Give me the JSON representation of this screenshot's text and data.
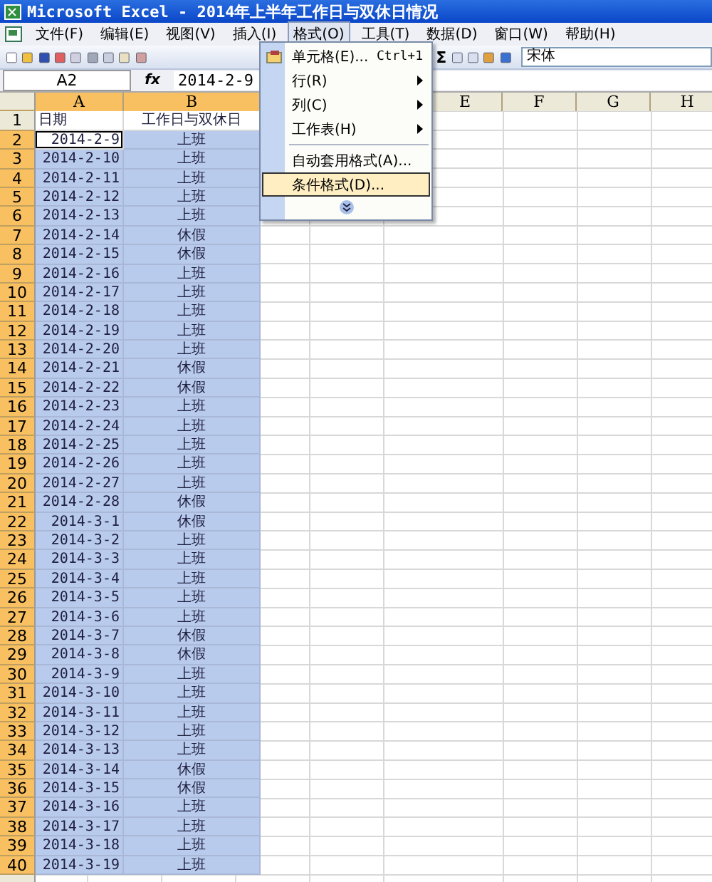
{
  "window": {
    "title": "Microsoft Excel - 2014年上半年工作日与双休日情况"
  },
  "menubar": [
    {
      "label": "文件(F)",
      "selected": false
    },
    {
      "label": "编辑(E)",
      "selected": false
    },
    {
      "label": "视图(V)",
      "selected": false
    },
    {
      "label": "插入(I)",
      "selected": false
    },
    {
      "label": "格式(O)",
      "selected": true
    },
    {
      "label": "工具(T)",
      "selected": false
    },
    {
      "label": "数据(D)",
      "selected": false
    },
    {
      "label": "窗口(W)",
      "selected": false
    },
    {
      "label": "帮助(H)",
      "selected": false
    }
  ],
  "toolbar": {
    "sum": "Σ",
    "font": "宋体"
  },
  "formula_bar": {
    "name_box": "A2",
    "fx": "fx",
    "value": "2014-2-9"
  },
  "format_menu": [
    {
      "kind": "item",
      "label": "单元格(E)...",
      "shortcut": "Ctrl+1",
      "submenu": false,
      "selected": false
    },
    {
      "kind": "item",
      "label": "行(R)",
      "submenu": true,
      "selected": false
    },
    {
      "kind": "item",
      "label": "列(C)",
      "submenu": true,
      "selected": false
    },
    {
      "kind": "item",
      "label": "工作表(H)",
      "submenu": true,
      "selected": false
    },
    {
      "kind": "separator"
    },
    {
      "kind": "item",
      "label": "自动套用格式(A)...",
      "submenu": false,
      "selected": false
    },
    {
      "kind": "item",
      "label": "条件格式(D)...",
      "submenu": false,
      "selected": true
    },
    {
      "kind": "expand"
    }
  ],
  "sheet": {
    "columns": [
      {
        "label": "A",
        "selected": true
      },
      {
        "label": "B",
        "selected": true
      },
      {
        "label": "E",
        "selected": false
      },
      {
        "label": "F",
        "selected": false
      },
      {
        "label": "G",
        "selected": false
      },
      {
        "label": "H",
        "selected": false
      }
    ],
    "rows": [
      {
        "number": "1",
        "date": "日期",
        "status": "工作日与双休日",
        "selected": false,
        "active": false
      },
      {
        "number": "2",
        "date": "2014-2-9",
        "status": "上班",
        "selected": true,
        "active": true
      },
      {
        "number": "3",
        "date": "2014-2-10",
        "status": "上班",
        "selected": true,
        "active": false
      },
      {
        "number": "4",
        "date": "2014-2-11",
        "status": "上班",
        "selected": true,
        "active": false
      },
      {
        "number": "5",
        "date": "2014-2-12",
        "status": "上班",
        "selected": true,
        "active": false
      },
      {
        "number": "6",
        "date": "2014-2-13",
        "status": "上班",
        "selected": true,
        "active": false
      },
      {
        "number": "7",
        "date": "2014-2-14",
        "status": "休假",
        "selected": true,
        "active": false
      },
      {
        "number": "8",
        "date": "2014-2-15",
        "status": "休假",
        "selected": true,
        "active": false
      },
      {
        "number": "9",
        "date": "2014-2-16",
        "status": "上班",
        "selected": true,
        "active": false
      },
      {
        "number": "10",
        "date": "2014-2-17",
        "status": "上班",
        "selected": true,
        "active": false
      },
      {
        "number": "11",
        "date": "2014-2-18",
        "status": "上班",
        "selected": true,
        "active": false
      },
      {
        "number": "12",
        "date": "2014-2-19",
        "status": "上班",
        "selected": true,
        "active": false
      },
      {
        "number": "13",
        "date": "2014-2-20",
        "status": "上班",
        "selected": true,
        "active": false
      },
      {
        "number": "14",
        "date": "2014-2-21",
        "status": "休假",
        "selected": true,
        "active": false
      },
      {
        "number": "15",
        "date": "2014-2-22",
        "status": "休假",
        "selected": true,
        "active": false
      },
      {
        "number": "16",
        "date": "2014-2-23",
        "status": "上班",
        "selected": true,
        "active": false
      },
      {
        "number": "17",
        "date": "2014-2-24",
        "status": "上班",
        "selected": true,
        "active": false
      },
      {
        "number": "18",
        "date": "2014-2-25",
        "status": "上班",
        "selected": true,
        "active": false
      },
      {
        "number": "19",
        "date": "2014-2-26",
        "status": "上班",
        "selected": true,
        "active": false
      },
      {
        "number": "20",
        "date": "2014-2-27",
        "status": "上班",
        "selected": true,
        "active": false
      },
      {
        "number": "21",
        "date": "2014-2-28",
        "status": "休假",
        "selected": true,
        "active": false
      },
      {
        "number": "22",
        "date": "2014-3-1",
        "status": "休假",
        "selected": true,
        "active": false
      },
      {
        "number": "23",
        "date": "2014-3-2",
        "status": "上班",
        "selected": true,
        "active": false
      },
      {
        "number": "24",
        "date": "2014-3-3",
        "status": "上班",
        "selected": true,
        "active": false
      },
      {
        "number": "25",
        "date": "2014-3-4",
        "status": "上班",
        "selected": true,
        "active": false
      },
      {
        "number": "26",
        "date": "2014-3-5",
        "status": "上班",
        "selected": true,
        "active": false
      },
      {
        "number": "27",
        "date": "2014-3-6",
        "status": "上班",
        "selected": true,
        "active": false
      },
      {
        "number": "28",
        "date": "2014-3-7",
        "status": "休假",
        "selected": true,
        "active": false
      },
      {
        "number": "29",
        "date": "2014-3-8",
        "status": "休假",
        "selected": true,
        "active": false
      },
      {
        "number": "30",
        "date": "2014-3-9",
        "status": "上班",
        "selected": true,
        "active": false
      },
      {
        "number": "31",
        "date": "2014-3-10",
        "status": "上班",
        "selected": true,
        "active": false
      },
      {
        "number": "32",
        "date": "2014-3-11",
        "status": "上班",
        "selected": true,
        "active": false
      },
      {
        "number": "33",
        "date": "2014-3-12",
        "status": "上班",
        "selected": true,
        "active": false
      },
      {
        "number": "34",
        "date": "2014-3-13",
        "status": "上班",
        "selected": true,
        "active": false
      },
      {
        "number": "35",
        "date": "2014-3-14",
        "status": "休假",
        "selected": true,
        "active": false
      },
      {
        "number": "36",
        "date": "2014-3-15",
        "status": "休假",
        "selected": true,
        "active": false
      },
      {
        "number": "37",
        "date": "2014-3-16",
        "status": "上班",
        "selected": true,
        "active": false
      },
      {
        "number": "38",
        "date": "2014-3-17",
        "status": "上班",
        "selected": true,
        "active": false
      },
      {
        "number": "39",
        "date": "2014-3-18",
        "status": "上班",
        "selected": true,
        "active": false
      },
      {
        "number": "40",
        "date": "2014-3-19",
        "status": "上班",
        "selected": true,
        "active": false
      }
    ]
  }
}
